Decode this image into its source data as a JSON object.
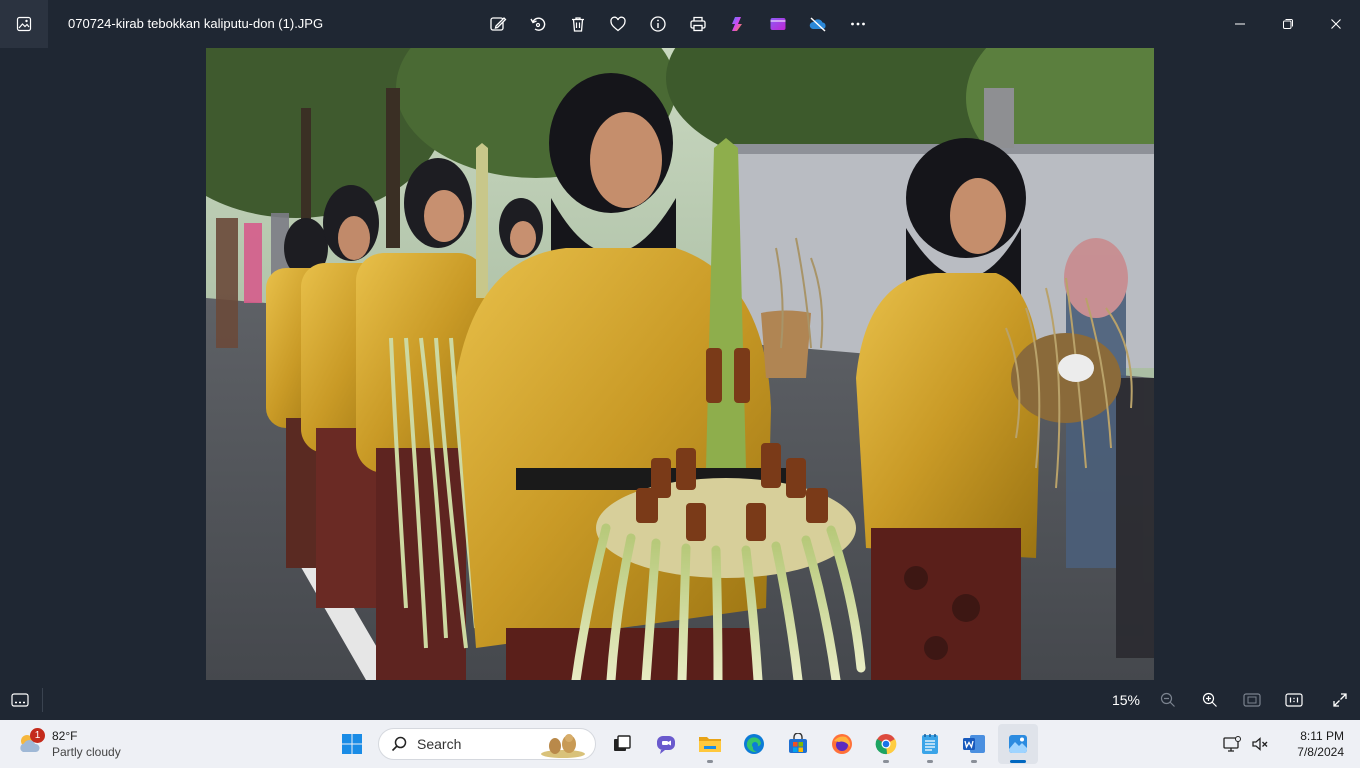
{
  "window": {
    "title": "070724-kirab tebokkan kaliputu-don (1).JPG",
    "toolbar_icons": [
      "edit-icon",
      "rotate-icon",
      "delete-icon",
      "favorite-icon",
      "info-icon",
      "print-icon",
      "copilot-icon",
      "clipchamp-icon",
      "onedrive-icon",
      "more-icon"
    ],
    "controls": [
      "minimize-icon",
      "restore-icon",
      "close-icon"
    ]
  },
  "viewer": {
    "zoom_level": "15%"
  },
  "taskbar": {
    "weather": {
      "temperature": "82°F",
      "condition": "Partly cloudy",
      "badge": "1"
    },
    "search_placeholder": "Search",
    "apps": [
      "start",
      "search",
      "task-view",
      "chat",
      "file-explorer",
      "edge",
      "store",
      "firefox",
      "chrome",
      "notepad",
      "word",
      "photos"
    ],
    "clock": {
      "time": "8:11 PM",
      "date": "7/8/2024"
    }
  },
  "colors": {
    "app_background": "#1f2733",
    "taskbar_background": "#eef0f5",
    "accent": "#0067c0"
  }
}
